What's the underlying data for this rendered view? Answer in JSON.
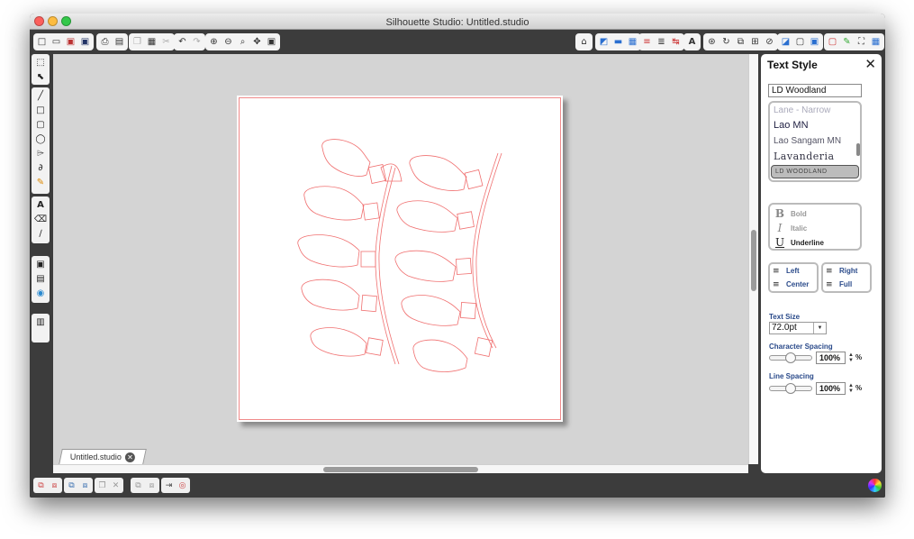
{
  "window": {
    "title": "Silhouette Studio: Untitled.studio"
  },
  "toolbar": {
    "left_groups": [
      [
        "new-file-icon",
        "open-file-icon",
        "save-icon",
        "save-library-icon"
      ],
      [
        "print-icon",
        "send-cutter-icon"
      ],
      [
        "copy-icon",
        "paste-icon",
        "cut-icon"
      ],
      [
        "undo-icon",
        "redo-icon"
      ],
      [
        "zoom-in-icon",
        "zoom-out-icon",
        "zoom-selection-icon",
        "pan-icon",
        "fit-page-icon"
      ]
    ],
    "right_groups": [
      [
        "silhouette-store-icon"
      ],
      [
        "fill-color-icon",
        "line-color-icon",
        "fill-pattern-icon"
      ],
      [
        "line-style-icon",
        "line-weight-icon",
        "cut-style-icon"
      ],
      [
        "text-style-icon"
      ],
      [
        "transform-icon",
        "rotate-icon",
        "scale-icon",
        "align-icon",
        "replicate-icon"
      ],
      [
        "modify-icon",
        "offset-icon",
        "trace-icon"
      ],
      [
        "page-setup-icon",
        "sketch-icon",
        "cut-settings-icon",
        "library-icon"
      ]
    ]
  },
  "left_toolbar": [
    "select-tool",
    "point-edit-tool",
    "line-tool",
    "rectangle-tool",
    "rounded-rectangle-tool",
    "ellipse-tool",
    "polygon-tool",
    "curve-tool",
    "freehand-tool",
    "text-tool",
    "eraser-tool",
    "knife-tool",
    "show-page-icon",
    "library-view-icon",
    "silhouette-connect-icon",
    "drawing-modes-icon"
  ],
  "document": {
    "tab_label": "Untitled.studio"
  },
  "bottom_toolbar": [
    "group-icon",
    "ungroup-icon",
    "make-compound-icon",
    "release-compound-icon",
    "duplicate-icon",
    "delete-icon",
    "bring-front-icon",
    "send-back-icon",
    "move-to-layer-icon",
    "registration-marks-icon"
  ],
  "text_style_panel": {
    "title": "Text Style",
    "font_search_value": "LD Woodland",
    "font_list": [
      "Lane - Narrow",
      "Lao MN",
      "Lao Sangam MN",
      "Lavanderia",
      "LD WOODLAND"
    ],
    "selected_font": "LD WOODLAND",
    "styles": [
      {
        "glyph": "B",
        "label": "Bold"
      },
      {
        "glyph": "I",
        "label": "Italic"
      },
      {
        "glyph": "U",
        "label": "Underline"
      }
    ],
    "alignment": {
      "left": "Left",
      "right": "Right",
      "center": "Center",
      "full": "Full"
    },
    "text_size_label": "Text Size",
    "text_size_value": "72.0pt",
    "character_spacing_label": "Character Spacing",
    "character_spacing_value": "100%",
    "line_spacing_label": "Line Spacing",
    "line_spacing_value": "100%",
    "percent_sign": "%"
  },
  "colors": {
    "cut_line": "#f07070",
    "canvas_bg": "#d4d4d4",
    "chrome": "#3c3c3c",
    "accent_label": "#2a4a8a"
  }
}
